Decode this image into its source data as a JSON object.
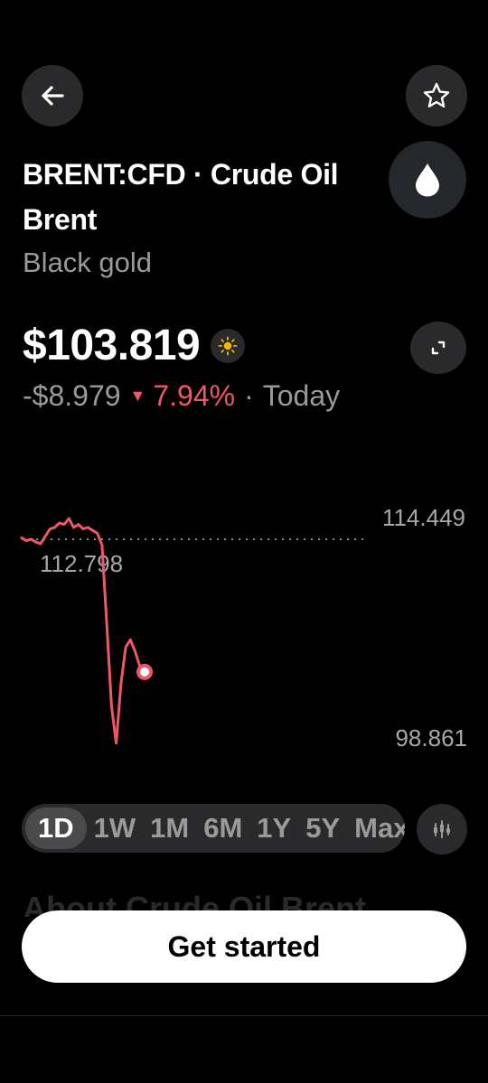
{
  "header": {
    "back_icon": "arrow-left-icon",
    "star_icon": "star-icon",
    "logo_icon": "oil-drop-icon"
  },
  "asset": {
    "title": "BRENT:CFD · Crude Oil Brent",
    "subtitle": "Black gold"
  },
  "quote": {
    "price": "$103.819",
    "market_icon": "sun-icon",
    "change_amount": "-$8.979",
    "change_percent": "7.94%",
    "period": "Today",
    "expand_icon": "expand-icon"
  },
  "chart_data": {
    "type": "line",
    "high_label": "114.449",
    "low_label": "98.861",
    "previous_close_label": "112.798",
    "ylim": [
      98.861,
      114.449
    ],
    "previous_close": 112.798,
    "current": 103.819,
    "series": [
      {
        "color": "#f0566a",
        "x": [
          0,
          1,
          2,
          3,
          4,
          5,
          6,
          7,
          8,
          9,
          10,
          11,
          12,
          13,
          14,
          15,
          16,
          17,
          18,
          19,
          20,
          21,
          22,
          23,
          24,
          25,
          26
        ],
        "values": [
          112.9,
          112.7,
          112.8,
          112.6,
          112.5,
          113.0,
          113.5,
          113.6,
          113.9,
          113.8,
          114.2,
          113.6,
          113.8,
          113.5,
          113.6,
          113.4,
          113.2,
          112.4,
          107.0,
          101.5,
          99.0,
          103.0,
          105.5,
          106.0,
          105.2,
          104.2,
          103.819
        ]
      }
    ]
  },
  "ranges": {
    "items": [
      "1D",
      "1W",
      "1M",
      "6M",
      "1Y",
      "5Y",
      "Max"
    ],
    "active": "1D",
    "chart_type_icon": "candlestick-icon"
  },
  "about": {
    "heading": "About Crude Oil Brent"
  },
  "cta": {
    "label": "Get started"
  },
  "colors": {
    "background": "#000000",
    "negative": "#f0566a",
    "muted": "#9a9a9a",
    "button_bg": "#2a2a2c"
  }
}
